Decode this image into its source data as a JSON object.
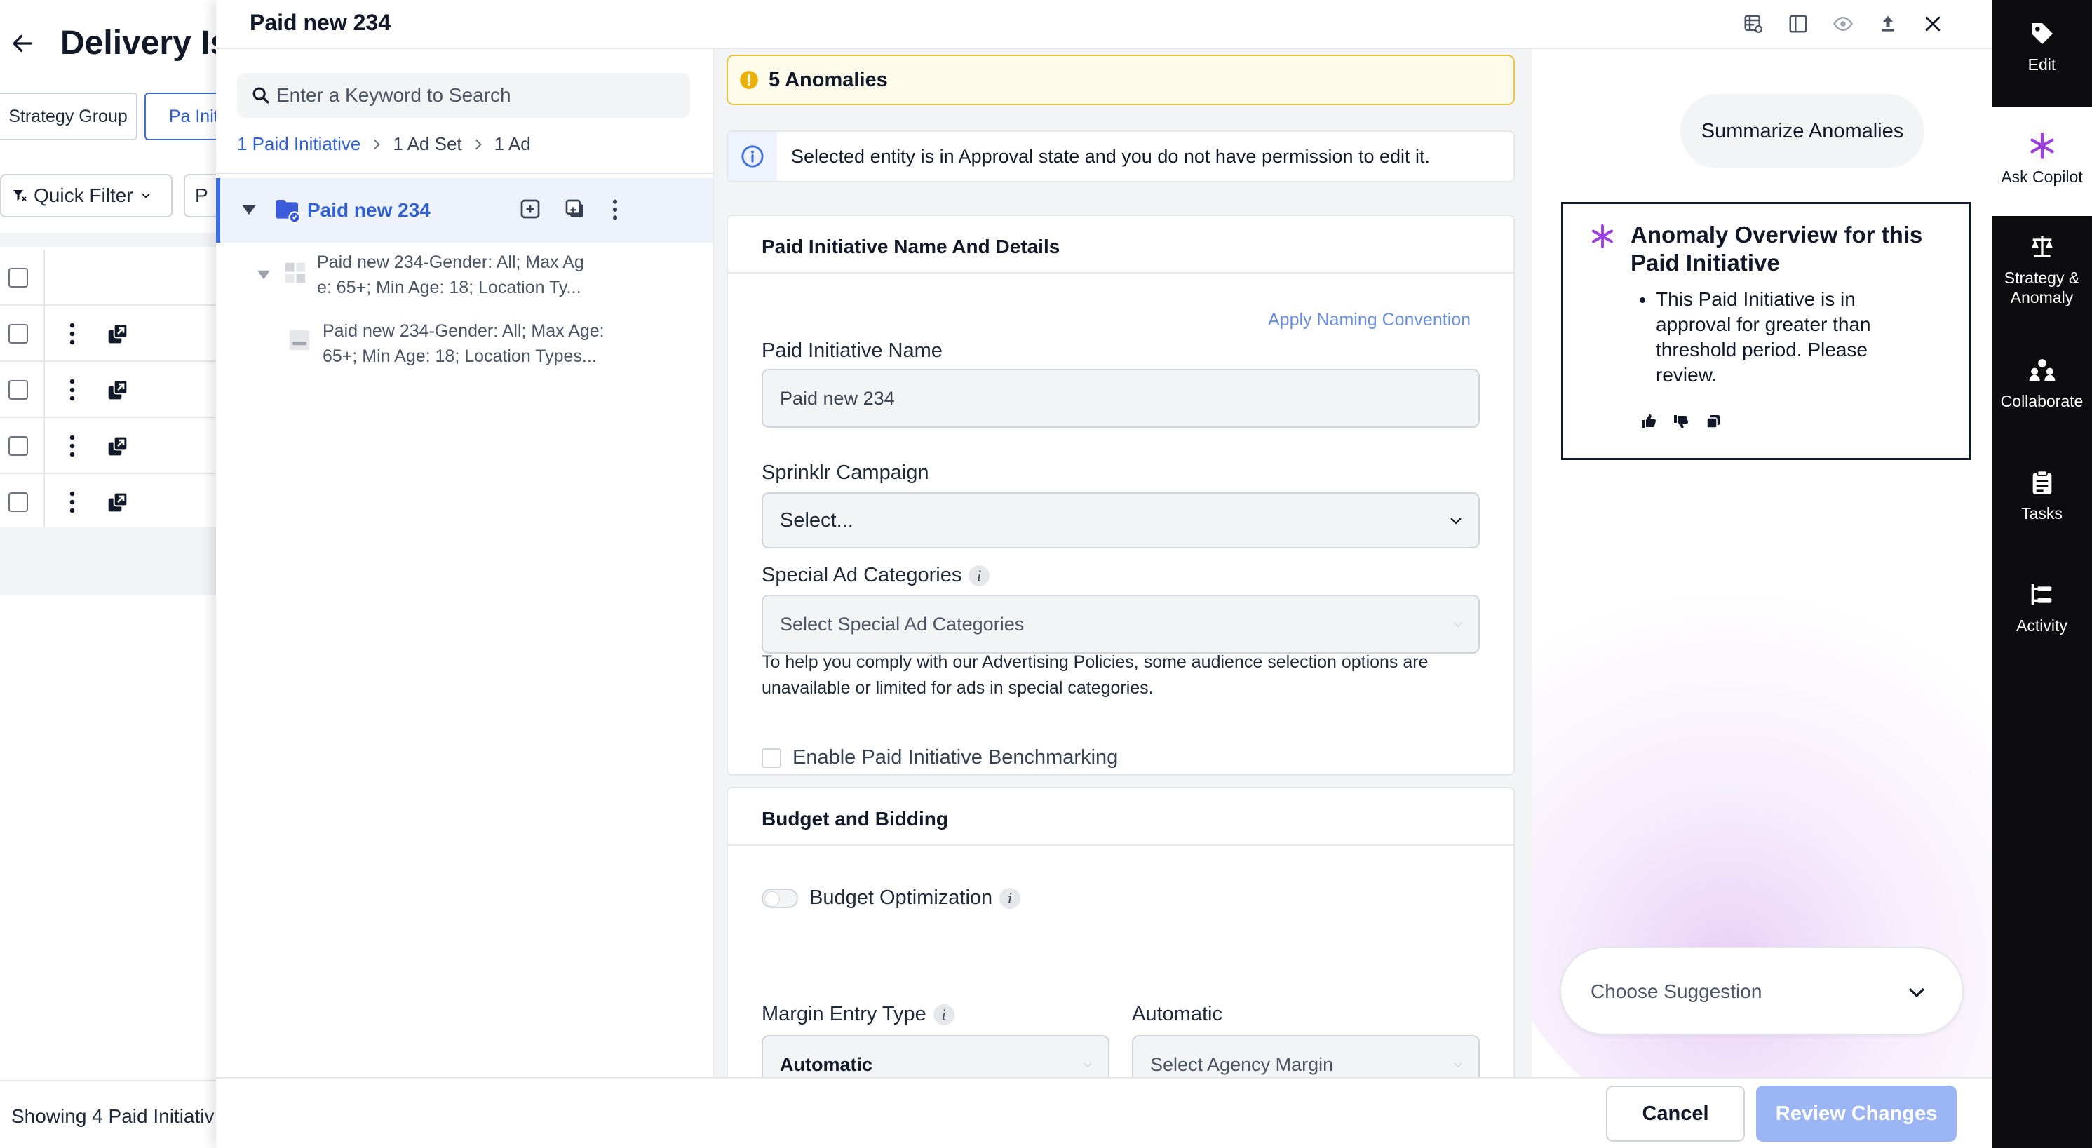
{
  "background_page": {
    "title": "Delivery Is",
    "tabs": [
      "Strategy Group",
      "Pa Initia"
    ],
    "filters": {
      "quick_filter": "Quick Filter",
      "second": "P"
    },
    "row_count": 4,
    "footer_text": "Showing 4 Paid Initiativ"
  },
  "drawer": {
    "title": "Paid new 234",
    "header_icons": [
      "table-settings-icon",
      "split-view-icon",
      "eye-icon",
      "upload-icon",
      "close-icon"
    ]
  },
  "tree": {
    "search_placeholder": "Enter a Keyword to Search",
    "breadcrumb": [
      "1 Paid Initiative",
      "1 Ad Set",
      "1 Ad"
    ],
    "selected_label": "Paid new 234",
    "ad_set_label_line1": "Paid new 234-Gender: All; Max Ag",
    "ad_set_label_line2": "e: 65+; Min Age: 18; Location Ty...",
    "ad_label_line1": "Paid new 234-Gender: All; Max Age:",
    "ad_label_line2": "65+; Min Age: 18; Location Types..."
  },
  "form": {
    "anomaly_banner": "5 Anomalies",
    "info_banner": "Selected entity is in Approval state and you do not have permission to edit it.",
    "details_section": {
      "title": "Paid Initiative Name And Details",
      "apply_naming": "Apply Naming Convention",
      "name_label": "Paid Initiative Name",
      "name_value": "Paid new 234",
      "campaign_label": "Sprinklr Campaign",
      "campaign_value": "Select...",
      "special_label": "Special Ad Categories",
      "special_placeholder": "Select Special Ad Categories",
      "help_text": "To help you comply with our Advertising Policies, some audience selection options are unavailable or limited for ads in special categories.",
      "benchmark_label": "Enable Paid Initiative Benchmarking"
    },
    "budget_section": {
      "title": "Budget and Bidding",
      "budget_opt_label": "Budget Optimization",
      "margin_label": "Margin Entry Type",
      "margin_value": "Automatic",
      "auto_label": "Automatic",
      "agency_placeholder": "Select Agency Margin"
    }
  },
  "copilot": {
    "summarize": "Summarize Anomalies",
    "overview_title": "Anomaly Overview for this Paid Initiative",
    "overview_points": [
      "This Paid Initiative is in approval for greater than threshold period. Please review."
    ],
    "suggestion": "Choose Suggestion"
  },
  "footer": {
    "cancel": "Cancel",
    "review": "Review Changes"
  },
  "rail": [
    {
      "label": "Edit",
      "icon": "tag-icon"
    },
    {
      "label": "Ask Copilot",
      "icon": "sparkle-icon"
    },
    {
      "label": "Strategy & Anomaly",
      "icon": "scale-icon"
    },
    {
      "label": "Collaborate",
      "icon": "people-icon"
    },
    {
      "label": "Tasks",
      "icon": "clipboard-icon"
    },
    {
      "label": "Activity",
      "icon": "activity-icon"
    }
  ],
  "colors": {
    "accent": "#3b6fe0",
    "review_button": "#9bb5f4",
    "anomaly_border": "#e8c548",
    "rail_bg": "#0d0d0f",
    "copilot_sparkle": "#9b3fe0"
  }
}
